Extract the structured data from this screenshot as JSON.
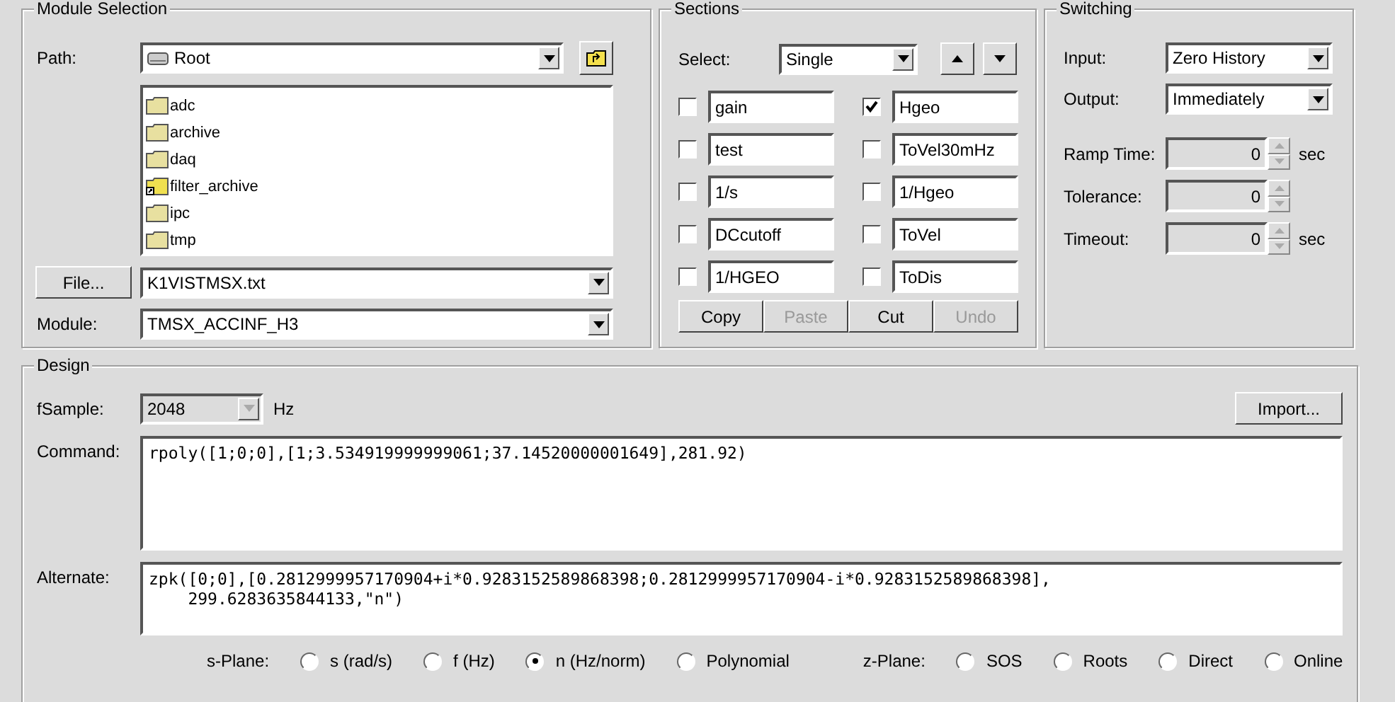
{
  "module_selection": {
    "title": "Module Selection",
    "path": {
      "label": "Path:",
      "value": "Root"
    },
    "folders": [
      {
        "name": "adc",
        "kind": "folder"
      },
      {
        "name": "archive",
        "kind": "folder"
      },
      {
        "name": "daq",
        "kind": "folder"
      },
      {
        "name": "filter_archive",
        "kind": "link"
      },
      {
        "name": "ipc",
        "kind": "folder"
      },
      {
        "name": "tmp",
        "kind": "folder"
      }
    ],
    "file_button": "File...",
    "file": "K1VISTMSX.txt",
    "module": {
      "label": "Module:",
      "value": "TMSX_ACCINF_H3"
    }
  },
  "sections": {
    "title": "Sections",
    "select": {
      "label": "Select:",
      "value": "Single"
    },
    "items": [
      {
        "name": "gain",
        "checked": false
      },
      {
        "name": "Hgeo",
        "checked": true
      },
      {
        "name": "test",
        "checked": false
      },
      {
        "name": "ToVel30mHz",
        "checked": false
      },
      {
        "name": "1/s",
        "checked": false
      },
      {
        "name": "1/Hgeo",
        "checked": false
      },
      {
        "name": "DCcutoff",
        "checked": false
      },
      {
        "name": "ToVel",
        "checked": false
      },
      {
        "name": "1/HGEO",
        "checked": false
      },
      {
        "name": "ToDis",
        "checked": false
      }
    ],
    "buttons": [
      {
        "label": "Copy",
        "disabled": false
      },
      {
        "label": "Paste",
        "disabled": true
      },
      {
        "label": "Cut",
        "disabled": false
      },
      {
        "label": "Undo",
        "disabled": true
      }
    ]
  },
  "switching": {
    "title": "Switching",
    "dropdowns": [
      {
        "label": "Input:",
        "value": "Zero History"
      },
      {
        "label": "Output:",
        "value": "Immediately"
      }
    ],
    "spinners": [
      {
        "label": "Ramp Time:",
        "value": "0",
        "unit": "sec",
        "disabled": true
      },
      {
        "label": "Tolerance:",
        "value": "0",
        "disabled": true
      },
      {
        "label": "Timeout:",
        "value": "0",
        "unit": "sec",
        "disabled": true
      }
    ]
  },
  "design": {
    "title": "Design",
    "fsample": {
      "label": "fSample:",
      "value": "2048",
      "unit": "Hz",
      "disabled": true
    },
    "import_button": "Import...",
    "command": {
      "label": "Command:",
      "value": "rpoly([1;0;0],[1;3.534919999999061;37.14520000001649],281.92)"
    },
    "alternate": {
      "label": "Alternate:",
      "value": "zpk([0;0],[0.2812999957170904+i*0.9283152589868398;0.2812999957170904-i*0.9283152589868398],\n    299.6283635844133,\"n\")"
    },
    "s_plane": {
      "label": "s-Plane:",
      "options": [
        {
          "label": "s (rad/s)",
          "selected": false
        },
        {
          "label": "f (Hz)",
          "selected": false
        },
        {
          "label": "n (Hz/norm)",
          "selected": true
        },
        {
          "label": "Polynomial",
          "selected": false
        }
      ]
    },
    "z_plane": {
      "label": "z-Plane:",
      "options": [
        {
          "label": "SOS",
          "selected": false
        },
        {
          "label": "Roots",
          "selected": false
        },
        {
          "label": "Direct",
          "selected": false
        },
        {
          "label": "Online",
          "selected": false
        }
      ]
    }
  }
}
